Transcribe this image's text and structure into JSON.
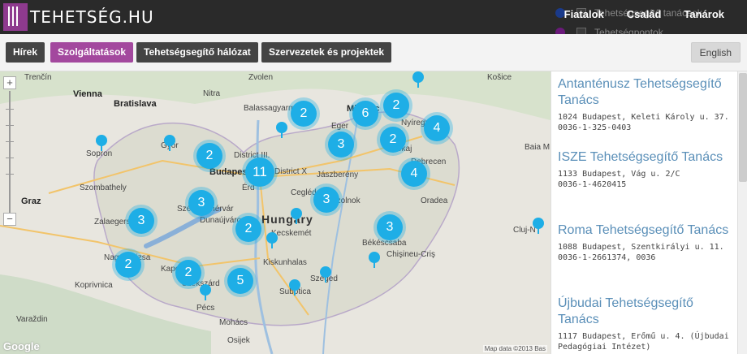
{
  "header": {
    "logo_text": "TEHETSÉG.HU",
    "nav": [
      "Fiatalok",
      "Család",
      "Tanárok"
    ],
    "legend": [
      {
        "label": "Tehetségsegítő tanácsok",
        "color": "#1a3a8a"
      },
      {
        "label": "Tehetségpontok",
        "color": "#6a1a7a"
      }
    ]
  },
  "subnav": {
    "buttons": [
      "Hírek",
      "Szolgáltatások",
      "Tehetségsegítő hálózat",
      "Szervezetek és projektek"
    ],
    "active": "Szolgáltatások",
    "lang": "English"
  },
  "map": {
    "country_label": "Hungary",
    "places": [
      "Trenčín",
      "Zvolen",
      "Košice",
      "Bratislava",
      "Balassagyarmat",
      "Miskolc",
      "Vienna",
      "Nitra",
      "Eger",
      "Nyíregyháza",
      "Sopron",
      "Győr",
      "District III.",
      "Tokaj",
      "Budapest",
      "District X",
      "Jászberény",
      "Debrecen",
      "Érd",
      "Cegléd",
      "Szolnok",
      "Oradea",
      "Graz",
      "Szombathely",
      "Székesfehérvár",
      "Dunaújváros",
      "Kecskemét",
      "Zalaegerszeg",
      "Baia M",
      "Cluj-N",
      "Békéscsaba",
      "Nagykanizsa",
      "Kaposvár",
      "Kiskunhalas",
      "Chişineu-Criş",
      "Koprivnica",
      "Szekszárd",
      "Szeged",
      "Subotica",
      "Mohács",
      "Pécs",
      "Varaždin",
      "Osijek"
    ],
    "clusters": [
      {
        "value": "2"
      },
      {
        "value": "6"
      },
      {
        "value": "2"
      },
      {
        "value": "4"
      },
      {
        "value": "3"
      },
      {
        "value": "2"
      },
      {
        "value": "2"
      },
      {
        "value": "11"
      },
      {
        "value": "4"
      },
      {
        "value": "3"
      },
      {
        "value": "3"
      },
      {
        "value": "3"
      },
      {
        "value": "2"
      },
      {
        "value": "3"
      },
      {
        "value": "2"
      },
      {
        "value": "2"
      },
      {
        "value": "5"
      }
    ],
    "attribution": "Map data ©2013 Bas",
    "google": "Google"
  },
  "list": [
    {
      "title": "Antanténusz Tehetségsegítő Tanács",
      "address": "1024 Budapest, Keleti Károly u. 37.",
      "phone": "0036-1-325-0403"
    },
    {
      "title": "ISZE Tehetségsegítő Tanács",
      "address": "1133 Budapest, Vág u. 2/C",
      "phone": "0036-1-4620415"
    },
    {
      "title": "Roma Tehetségsegítő Tanács",
      "address": "1088 Budapest, Szentkirályi u. 11.",
      "phone": "0036-1-2661374, 0036"
    },
    {
      "title": "Újbudai Tehetségsegítő Tanács",
      "address": "1117 Budapest, Erőmű u. 4. (Újbudai Pedagógiai Intézet)",
      "phone": ""
    }
  ]
}
